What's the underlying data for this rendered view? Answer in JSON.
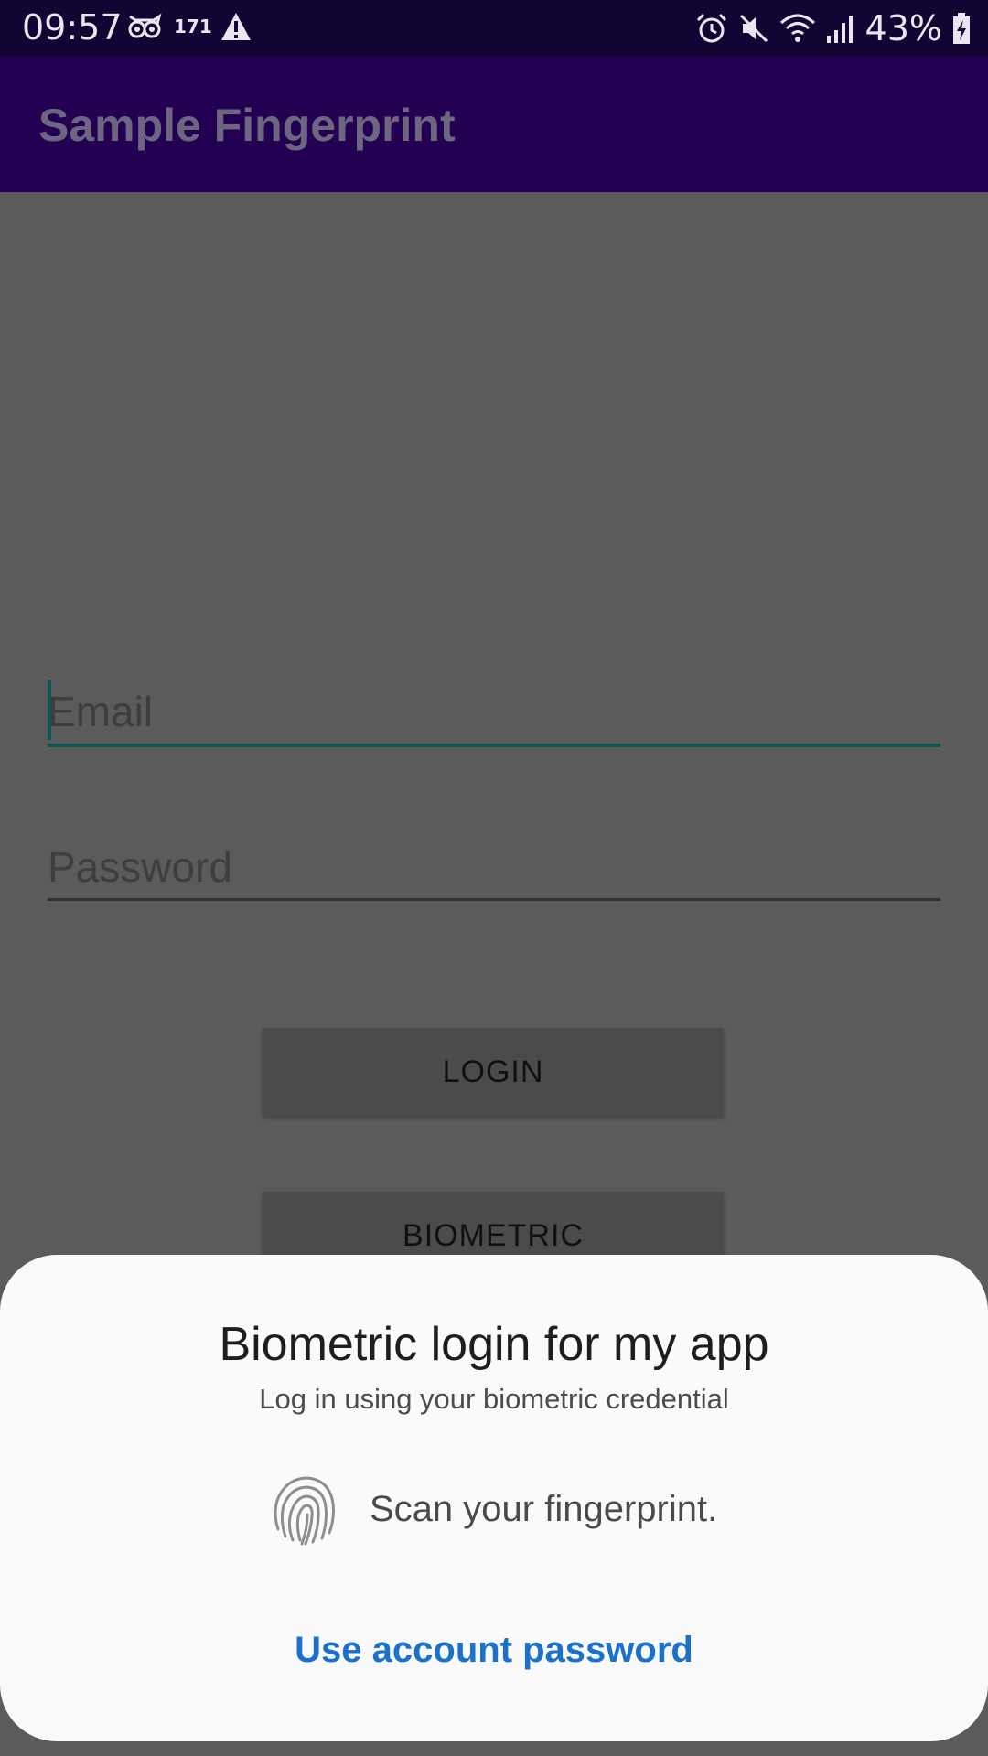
{
  "status_bar": {
    "time": "09:57",
    "notification_count": "171",
    "battery": "43%",
    "icons": [
      "owl-icon",
      "warning-icon",
      "alarm-icon",
      "mute-icon",
      "wifi-icon",
      "signal-icon",
      "battery-charging-icon"
    ]
  },
  "app_bar": {
    "title": "Sample Fingerprint"
  },
  "form": {
    "email_placeholder": "Email",
    "password_placeholder": "Password",
    "login_label": "LOGIN",
    "biometric_label": "BIOMETRIC"
  },
  "biometric_prompt": {
    "title": "Biometric login for my app",
    "subtitle": "Log in using your biometric credential",
    "instruction": "Scan your fingerprint.",
    "negative_button": "Use account password"
  },
  "colors": {
    "status_bar": "#120433",
    "app_bar": "#230052",
    "accent": "#0c5553",
    "link": "#1b70cc"
  }
}
